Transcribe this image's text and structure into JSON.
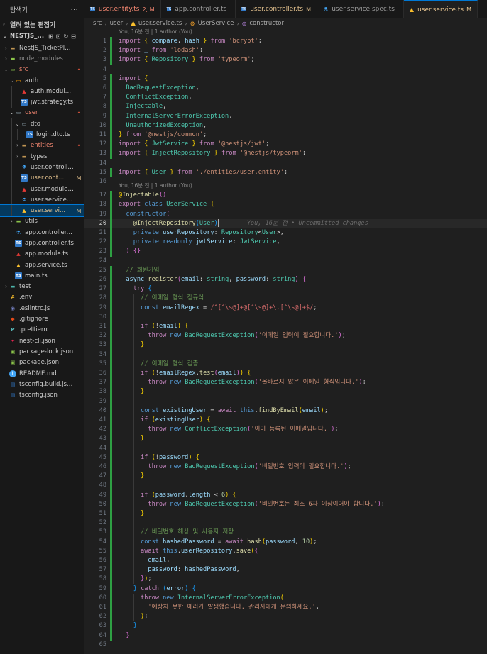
{
  "explorer": {
    "title": "탐색기",
    "more": "···",
    "open_editors": "열려 있는 편집기",
    "project": "NESTJS_...",
    "tree": [
      {
        "label": "NestJS_TicketPlatf...",
        "depth": 1,
        "chev": "›",
        "icon": "folder",
        "color": "c-white",
        "badge": ""
      },
      {
        "label": "node_modules",
        "depth": 1,
        "chev": "›",
        "icon": "folder-green",
        "color": "c-muted",
        "badge": ""
      },
      {
        "label": "src",
        "depth": 1,
        "chev": "⌄",
        "icon": "folder-open-green",
        "color": "c-red",
        "badge": "•"
      },
      {
        "label": "auth",
        "depth": 2,
        "chev": "⌄",
        "icon": "folder-open-orange",
        "color": "c-white",
        "badge": ""
      },
      {
        "label": "auth.module.ts",
        "depth": 3,
        "chev": "",
        "icon": "angular",
        "color": "c-white",
        "badge": ""
      },
      {
        "label": "jwt.strategy.ts",
        "depth": 3,
        "chev": "",
        "icon": "ts",
        "color": "c-white",
        "badge": ""
      },
      {
        "label": "user",
        "depth": 2,
        "chev": "⌄",
        "icon": "folder-open",
        "color": "c-red",
        "badge": "•"
      },
      {
        "label": "dto",
        "depth": 3,
        "chev": "⌄",
        "icon": "folder-open",
        "color": "c-white",
        "badge": ""
      },
      {
        "label": "login.dto.ts",
        "depth": 4,
        "chev": "",
        "icon": "ts",
        "color": "c-white",
        "badge": ""
      },
      {
        "label": "entities",
        "depth": 3,
        "chev": "›",
        "icon": "folder",
        "color": "c-red",
        "badge": "•"
      },
      {
        "label": "types",
        "depth": 3,
        "chev": "›",
        "icon": "folder",
        "color": "c-white",
        "badge": ""
      },
      {
        "label": "user.controller....",
        "depth": 3,
        "chev": "",
        "icon": "test",
        "color": "c-white",
        "badge": ""
      },
      {
        "label": "user.cont...",
        "depth": 3,
        "chev": "",
        "icon": "ts",
        "color": "c-orange",
        "badge": "M"
      },
      {
        "label": "user.module.ts",
        "depth": 3,
        "chev": "",
        "icon": "angular",
        "color": "c-white",
        "badge": ""
      },
      {
        "label": "user.service.sp...",
        "depth": 3,
        "chev": "",
        "icon": "test",
        "color": "c-white",
        "badge": ""
      },
      {
        "label": "user.servi...",
        "depth": 3,
        "chev": "",
        "icon": "angular-yellow",
        "color": "c-orange",
        "badge": "M",
        "selected": true
      },
      {
        "label": "utils",
        "depth": 2,
        "chev": "›",
        "icon": "folder-green",
        "color": "c-white",
        "badge": ""
      },
      {
        "label": "app.controller.s...",
        "depth": 2,
        "chev": "",
        "icon": "test",
        "color": "c-white",
        "badge": ""
      },
      {
        "label": "app.controller.ts",
        "depth": 2,
        "chev": "",
        "icon": "ts",
        "color": "c-white",
        "badge": ""
      },
      {
        "label": "app.module.ts",
        "depth": 2,
        "chev": "",
        "icon": "angular",
        "color": "c-white",
        "badge": ""
      },
      {
        "label": "app.service.ts",
        "depth": 2,
        "chev": "",
        "icon": "angular-yellow",
        "color": "c-white",
        "badge": ""
      },
      {
        "label": "main.ts",
        "depth": 2,
        "chev": "",
        "icon": "ts",
        "color": "c-white",
        "badge": ""
      },
      {
        "label": "test",
        "depth": 1,
        "chev": "›",
        "icon": "folder-test",
        "color": "c-white",
        "badge": ""
      },
      {
        "label": ".env",
        "depth": 1,
        "chev": "",
        "icon": "env",
        "color": "c-white",
        "badge": ""
      },
      {
        "label": ".eslintrc.js",
        "depth": 1,
        "chev": "",
        "icon": "eslint",
        "color": "c-white",
        "badge": ""
      },
      {
        "label": ".gitignore",
        "depth": 1,
        "chev": "",
        "icon": "git",
        "color": "c-white",
        "badge": ""
      },
      {
        "label": ".prettierrc",
        "depth": 1,
        "chev": "",
        "icon": "prettier",
        "color": "c-white",
        "badge": ""
      },
      {
        "label": "nest-cli.json",
        "depth": 1,
        "chev": "",
        "icon": "nest",
        "color": "c-white",
        "badge": ""
      },
      {
        "label": "package-lock.json",
        "depth": 1,
        "chev": "",
        "icon": "npm",
        "color": "c-white",
        "badge": ""
      },
      {
        "label": "package.json",
        "depth": 1,
        "chev": "",
        "icon": "npm",
        "color": "c-white",
        "badge": ""
      },
      {
        "label": "README.md",
        "depth": 1,
        "chev": "",
        "icon": "info",
        "color": "c-white",
        "badge": ""
      },
      {
        "label": "tsconfig.build.json",
        "depth": 1,
        "chev": "",
        "icon": "tsconfig",
        "color": "c-white",
        "badge": ""
      },
      {
        "label": "tsconfig.json",
        "depth": 1,
        "chev": "",
        "icon": "tsconfig",
        "color": "c-white",
        "badge": ""
      }
    ]
  },
  "tabs": [
    {
      "label": "user.entity.ts",
      "mod": "2, M",
      "icon": "ts",
      "labelColor": "#f48771",
      "modColor": "#f48771"
    },
    {
      "label": "app.controller.ts",
      "mod": "",
      "icon": "ts",
      "labelColor": "#9d9d9d",
      "modColor": ""
    },
    {
      "label": "user.controller.ts",
      "mod": "M",
      "icon": "ts",
      "labelColor": "#e2c08d",
      "modColor": "#e2c08d"
    },
    {
      "label": "user.service.spec.ts",
      "mod": "",
      "icon": "test",
      "labelColor": "#9d9d9d",
      "modColor": ""
    },
    {
      "label": "user.service.ts",
      "mod": "M",
      "icon": "angular-yellow",
      "labelColor": "#e2c08d",
      "modColor": "#e2c08d",
      "active": true
    }
  ],
  "breadcrumb": [
    "src",
    "user",
    "user.service.ts",
    "UserService",
    "constructor"
  ],
  "codelens": [
    {
      "before_line": 1,
      "text": "You, 16분 전 | 1 author (You)"
    },
    {
      "before_line": 17,
      "text": "You, 16분 전 | 1 author (You)"
    }
  ],
  "inline_blame": {
    "line": 20,
    "text": "You, 16분 전 • Uncommitted changes"
  },
  "current_line": 20,
  "lines": [
    [
      1,
      "1",
      "<span class='k'>import</span> <span class='y'>{</span> <span class='v'>compare</span>, <span class='v'>hash</span> <span class='y'>}</span> <span class='k'>from</span> <span class='s'>'bcrypt'</span>;"
    ],
    [
      2,
      "1",
      "<span class='k'>import</span> <span class='v'>_</span> <span class='k'>from</span> <span class='s'>'lodash'</span>;"
    ],
    [
      3,
      "1",
      "<span class='k'>import</span> <span class='y'>{</span> <span class='t'>Repository</span> <span class='y'>}</span> <span class='k'>from</span> <span class='s'>'typeorm'</span>;"
    ],
    [
      4,
      "0",
      ""
    ],
    [
      5,
      "1",
      "<span class='k'>import</span> <span class='y'>{</span>"
    ],
    [
      6,
      "1",
      "  <span class='t'>BadRequestException</span>,"
    ],
    [
      7,
      "1",
      "  <span class='t'>ConflictException</span>,"
    ],
    [
      8,
      "1",
      "  <span class='t'>Injectable</span>,"
    ],
    [
      9,
      "1",
      "  <span class='t'>InternalServerErrorException</span>,"
    ],
    [
      10,
      "1",
      "  <span class='t'>UnauthorizedException</span>,"
    ],
    [
      11,
      "1",
      "<span class='y'>}</span> <span class='k'>from</span> <span class='s'>'@nestjs/common'</span>;"
    ],
    [
      12,
      "1",
      "<span class='k'>import</span> <span class='y'>{</span> <span class='t'>JwtService</span> <span class='y'>}</span> <span class='k'>from</span> <span class='s'>'@nestjs/jwt'</span>;"
    ],
    [
      13,
      "1",
      "<span class='k'>import</span> <span class='y'>{</span> <span class='t'>InjectRepository</span> <span class='y'>}</span> <span class='k'>from</span> <span class='s'>'@nestjs/typeorm'</span>;"
    ],
    [
      14,
      "0",
      ""
    ],
    [
      15,
      "1",
      "<span class='k'>import</span> <span class='y'>{</span> <span class='t'>User</span> <span class='y'>}</span> <span class='k'>from</span> <span class='s'>'./entities/user.entity'</span>;"
    ],
    [
      16,
      "0",
      ""
    ],
    [
      17,
      "1",
      "<span class='y'>@</span><span class='f'>Injectable</span><span class='m'>()</span>"
    ],
    [
      18,
      "1",
      "<span class='k'>export</span> <span class='b'>class</span> <span class='t'>UserService</span> <span class='y'>{</span>"
    ],
    [
      19,
      "1",
      "  <span class='b'>constructor</span><span class='m'>(</span>"
    ],
    [
      20,
      "1",
      "    <span class='f'>@InjectRepository</span><span class='bl'>(</span><span class='t'>User</span><span class='bl'>)</span>"
    ],
    [
      21,
      "1",
      "    <span class='b'>private</span> <span class='v'>userRepository</span>: <span class='t'>Repository</span><span class='p'>&lt;</span><span class='t'>User</span><span class='p'>&gt;</span>,"
    ],
    [
      22,
      "1",
      "    <span class='b'>private</span> <span class='b'>readonly</span> <span class='v'>jwtService</span>: <span class='t'>JwtService</span>,"
    ],
    [
      23,
      "1",
      "  <span class='m'>)</span> <span class='m'>{}</span>"
    ],
    [
      24,
      "0",
      ""
    ],
    [
      25,
      "1",
      "  <span class='c'>// 회원가입</span>"
    ],
    [
      26,
      "1",
      "  <span class='v'>async</span> <span class='f'>register</span><span class='m'>(</span><span class='v'>email</span>: <span class='t'>string</span>, <span class='v'>password</span>: <span class='t'>string</span><span class='m'>)</span> <span class='m'>{</span>"
    ],
    [
      27,
      "1",
      "    <span class='k'>try</span> <span class='bl'>{</span>"
    ],
    [
      28,
      "1",
      "      <span class='c'>// 이메일 형식 정규식</span>"
    ],
    [
      29,
      "1",
      "      <span class='b'>const</span> <span class='v'>emailRegex</span> = <span class='r'>/^[^\\s@]+@[^\\s@]+\\.[^\\s@]+$/</span>;"
    ],
    [
      30,
      "1",
      ""
    ],
    [
      31,
      "1",
      "      <span class='k'>if</span> <span class='y'>(</span>!<span class='v'>email</span><span class='y'>)</span> <span class='y'>{</span>"
    ],
    [
      32,
      "1",
      "        <span class='k'>throw</span> <span class='b'>new</span> <span class='t'>BadRequestException</span><span class='m'>(</span><span class='s'>'이메일 입력이 필요합니다.'</span><span class='m'>)</span>;"
    ],
    [
      33,
      "1",
      "      <span class='y'>}</span>"
    ],
    [
      34,
      "1",
      ""
    ],
    [
      35,
      "1",
      "      <span class='c'>// 이메일 형식 검증</span>"
    ],
    [
      36,
      "1",
      "      <span class='k'>if</span> <span class='y'>(</span>!<span class='v'>emailRegex</span>.<span class='f'>test</span><span class='m'>(</span><span class='v'>email</span><span class='m'>)</span><span class='y'>)</span> <span class='y'>{</span>"
    ],
    [
      37,
      "1",
      "        <span class='k'>throw</span> <span class='b'>new</span> <span class='t'>BadRequestException</span><span class='m'>(</span><span class='s'>'올바르지 않은 이메일 형식입니다.'</span><span class='m'>)</span>;"
    ],
    [
      38,
      "1",
      "      <span class='y'>}</span>"
    ],
    [
      39,
      "1",
      ""
    ],
    [
      40,
      "1",
      "      <span class='b'>const</span> <span class='v'>existingUser</span> = <span class='k'>await</span> <span class='b'>this</span>.<span class='f'>findByEmail</span><span class='y'>(</span><span class='v'>email</span><span class='y'>)</span>;"
    ],
    [
      41,
      "1",
      "      <span class='k'>if</span> <span class='y'>(</span><span class='v'>existingUser</span><span class='y'>)</span> <span class='y'>{</span>"
    ],
    [
      42,
      "1",
      "        <span class='k'>throw</span> <span class='b'>new</span> <span class='t'>ConflictException</span><span class='m'>(</span><span class='s'>'이미 등록된 이메일입니다.'</span><span class='m'>)</span>;"
    ],
    [
      43,
      "1",
      "      <span class='y'>}</span>"
    ],
    [
      44,
      "1",
      ""
    ],
    [
      45,
      "1",
      "      <span class='k'>if</span> <span class='y'>(</span>!<span class='v'>password</span><span class='y'>)</span> <span class='y'>{</span>"
    ],
    [
      46,
      "1",
      "        <span class='k'>throw</span> <span class='b'>new</span> <span class='t'>BadRequestException</span><span class='m'>(</span><span class='s'>'비밀번호 입력이 필요합니다.'</span><span class='m'>)</span>;"
    ],
    [
      47,
      "1",
      "      <span class='y'>}</span>"
    ],
    [
      48,
      "1",
      ""
    ],
    [
      49,
      "1",
      "      <span class='k'>if</span> <span class='y'>(</span><span class='v'>password</span>.<span class='v'>length</span> &lt; <span class='n'>6</span><span class='y'>)</span> <span class='y'>{</span>"
    ],
    [
      50,
      "1",
      "        <span class='k'>throw</span> <span class='b'>new</span> <span class='t'>BadRequestException</span><span class='m'>(</span><span class='s'>'비밀번호는 최소 6자 이상이어야 합니다.'</span><span class='m'>)</span>;"
    ],
    [
      51,
      "1",
      "      <span class='y'>}</span>"
    ],
    [
      52,
      "1",
      ""
    ],
    [
      53,
      "1",
      "      <span class='c'>// 비밀번호 해싱 및 사용자 저장</span>"
    ],
    [
      54,
      "1",
      "      <span class='b'>const</span> <span class='v'>hashedPassword</span> = <span class='k'>await</span> <span class='f'>hash</span><span class='y'>(</span><span class='v'>password</span>, <span class='n'>10</span><span class='y'>)</span>;"
    ],
    [
      55,
      "1",
      "      <span class='k'>await</span> <span class='b'>this</span>.<span class='v'>userRepository</span>.<span class='f'>save</span><span class='y'>(</span><span class='m'>{</span>"
    ],
    [
      56,
      "1",
      "        <span class='v'>email</span>,"
    ],
    [
      57,
      "1",
      "        <span class='v'>password</span>: <span class='v'>hashedPassword</span>,"
    ],
    [
      58,
      "1",
      "      <span class='m'>}</span><span class='y'>)</span>;"
    ],
    [
      59,
      "1",
      "    <span class='bl'>}</span> <span class='k'>catch</span> <span class='bl'>(</span><span class='v'>error</span><span class='bl'>)</span> <span class='bl'>{</span>"
    ],
    [
      60,
      "1",
      "      <span class='k'>throw</span> <span class='b'>new</span> <span class='t'>InternalServerErrorException</span><span class='y'>(</span>"
    ],
    [
      61,
      "1",
      "        <span class='s'>'예상치 못한 에러가 발생했습니다. 관리자에게 문의하세요.'</span>,"
    ],
    [
      62,
      "1",
      "      <span class='y'>)</span>;"
    ],
    [
      63,
      "1",
      "    <span class='bl'>}</span>"
    ],
    [
      64,
      "1",
      "  <span class='m'>}</span>"
    ],
    [
      65,
      "0",
      ""
    ]
  ]
}
